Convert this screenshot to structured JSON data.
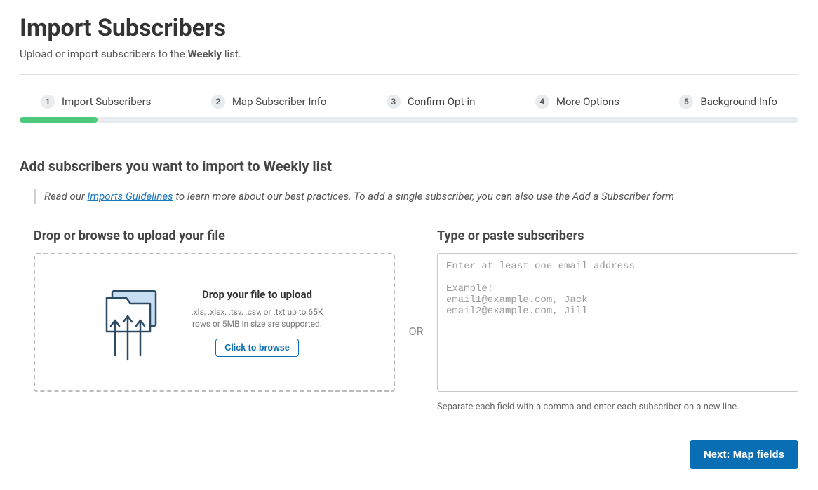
{
  "header": {
    "title": "Import Subscribers",
    "subtitle_pre": "Upload or import subscribers to the ",
    "subtitle_bold": "Weekly",
    "subtitle_post": " list."
  },
  "stepper": {
    "steps": [
      {
        "num": "1",
        "label": "Import Subscribers"
      },
      {
        "num": "2",
        "label": "Map Subscriber Info"
      },
      {
        "num": "3",
        "label": "Confirm Opt-in"
      },
      {
        "num": "4",
        "label": "More Options"
      },
      {
        "num": "5",
        "label": "Background Info"
      }
    ],
    "progress_percent": 10
  },
  "section": {
    "title": "Add subscribers you want to import to Weekly list",
    "info_pre": "Read our ",
    "info_link": "Imports Guidelines",
    "info_post": " to learn more about our best practices. To add a single subscriber, you can also use the Add a Subscriber form"
  },
  "upload": {
    "panel_title": "Drop or browse to upload your file",
    "drop_heading": "Drop your file to upload",
    "drop_sub": ".xls, .xlsx, .tsv, .csv, or .txt up to 65K rows or 5MB in size are supported.",
    "browse_label": "Click to browse"
  },
  "or_text": "OR",
  "paste": {
    "panel_title": "Type or paste subscribers",
    "placeholder": "Enter at least one email address\n\nExample:\nemail1@example.com, Jack\nemail2@example.com, Jill",
    "hint": "Separate each field with a comma and enter each subscriber on a new line."
  },
  "footer": {
    "next_label": "Next: Map fields"
  }
}
